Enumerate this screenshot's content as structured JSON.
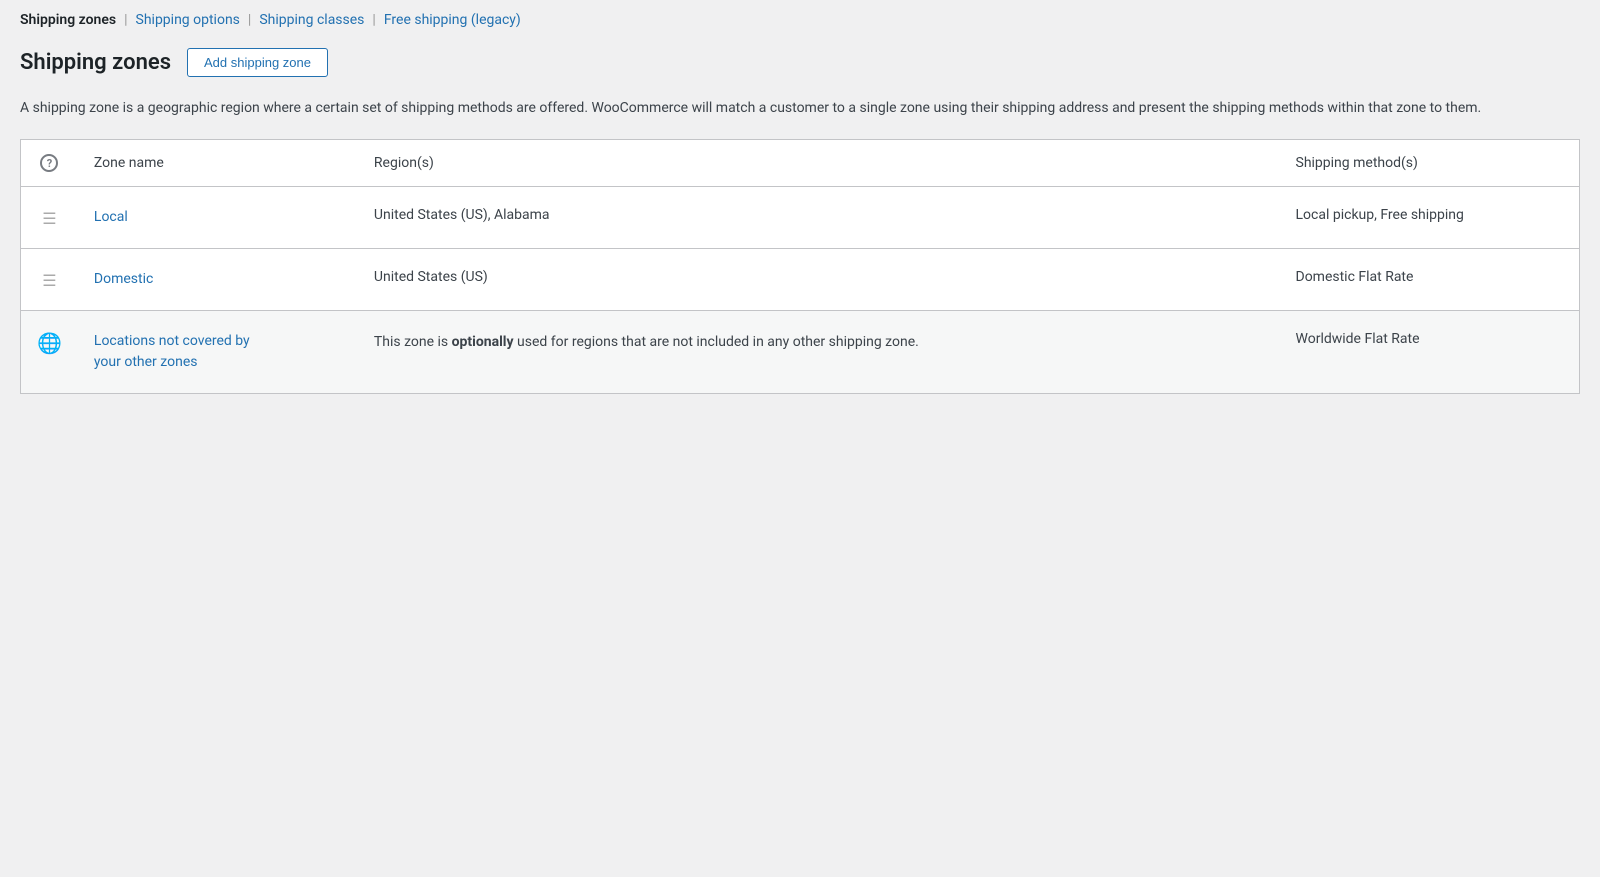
{
  "nav": {
    "items": [
      {
        "id": "shipping-zones",
        "label": "Shipping zones",
        "active": true
      },
      {
        "id": "shipping-options",
        "label": "Shipping options",
        "active": false
      },
      {
        "id": "shipping-classes",
        "label": "Shipping classes",
        "active": false
      },
      {
        "id": "free-shipping-legacy",
        "label": "Free shipping (legacy)",
        "active": false
      }
    ]
  },
  "header": {
    "title": "Shipping zones",
    "add_button_label": "Add shipping zone"
  },
  "description": "A shipping zone is a geographic region where a certain set of shipping methods are offered. WooCommerce will match a customer to a single zone using their shipping address and present the shipping methods within that zone to them.",
  "table": {
    "columns": [
      {
        "id": "handle",
        "label": ""
      },
      {
        "id": "zone-name",
        "label": "Zone name"
      },
      {
        "id": "regions",
        "label": "Region(s)"
      },
      {
        "id": "shipping-methods",
        "label": "Shipping method(s)"
      }
    ],
    "rows": [
      {
        "id": "local",
        "name": "Local",
        "regions": "United States (US), Alabama",
        "methods": "Local pickup, Free shipping",
        "type": "normal"
      },
      {
        "id": "domestic",
        "name": "Domestic",
        "regions": "United States (US)",
        "methods": "Domestic Flat Rate",
        "type": "normal"
      }
    ],
    "fallback_row": {
      "id": "locations-not-covered",
      "name_line1": "Locations not covered by",
      "name_line2": "your other zones",
      "description_prefix": "This zone is ",
      "description_bold": "optionally",
      "description_suffix": " used for regions that are not included in any other shipping zone.",
      "methods": "Worldwide Flat Rate"
    }
  }
}
